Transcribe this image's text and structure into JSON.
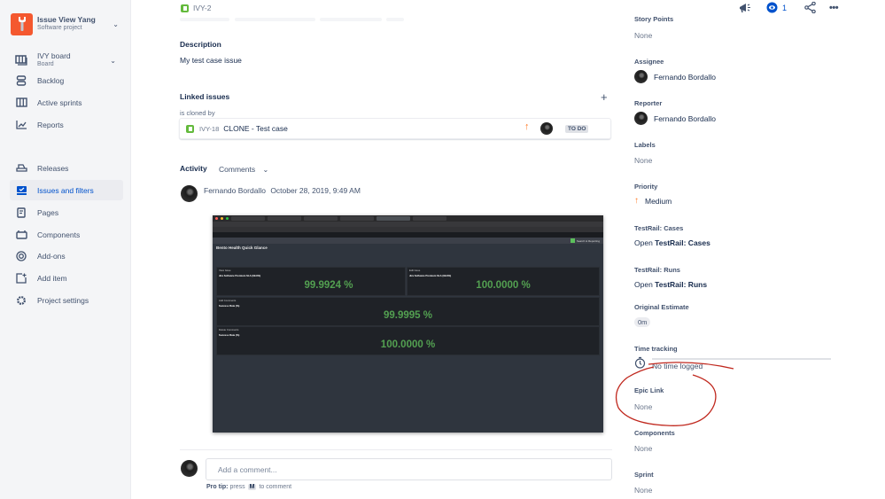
{
  "sidebar": {
    "project": {
      "name": "Issue View Yang",
      "type": "Software project",
      "icon": "wrench-icon",
      "brand_color": "#f4582f"
    },
    "board": {
      "name": "IVY board",
      "sub": "Board"
    },
    "items": [
      {
        "label": "Backlog",
        "icon": "backlog-icon"
      },
      {
        "label": "Active sprints",
        "icon": "sprints-icon"
      },
      {
        "label": "Reports",
        "icon": "reports-icon"
      },
      {
        "label": "Releases",
        "icon": "releases-icon"
      },
      {
        "label": "Issues and filters",
        "icon": "issues-icon",
        "active": true
      },
      {
        "label": "Pages",
        "icon": "pages-icon"
      },
      {
        "label": "Components",
        "icon": "components-icon"
      },
      {
        "label": "Add-ons",
        "icon": "addons-icon"
      },
      {
        "label": "Add item",
        "icon": "add-item-icon"
      },
      {
        "label": "Project settings",
        "icon": "settings-icon"
      }
    ]
  },
  "issue": {
    "key": "IVY-2",
    "description_heading": "Description",
    "description": "My test case issue",
    "linked": {
      "heading": "Linked issues",
      "relation": "is cloned by",
      "items": [
        {
          "key": "IVY-18",
          "summary": "CLONE - Test case",
          "priority": "Medium",
          "status": "TO DO"
        }
      ]
    },
    "activity": {
      "heading": "Activity",
      "filter": "Comments",
      "comments": [
        {
          "author": "Fernando Bordallo",
          "date": "October 28, 2019, 9:49 AM"
        }
      ]
    },
    "comment_box": {
      "placeholder": "Add a comment...",
      "protip_label": "Pro tip:",
      "protip_pre": "press",
      "protip_key": "M",
      "protip_post": "to comment"
    }
  },
  "embedded_screenshot": {
    "app_name": "Search & Reporting",
    "dashboard_title": "Bento Health Quick Glance",
    "panels": [
      {
        "title": "View Issue",
        "subtitle": "Jira Software Premium SLA (99.9%)",
        "value": "99.9924 %"
      },
      {
        "title": "Edit Issue",
        "subtitle": "Jira Software Premium SLA (99.9%)",
        "value": "100.0000 %"
      },
      {
        "title": "Add Comments",
        "subtitle": "Success Rate (%)",
        "value": "99.9995 %"
      },
      {
        "title": "Delete Comments",
        "subtitle": "Success Rate (%)",
        "value": "100.0000 %"
      }
    ],
    "value_color": "#53a051"
  },
  "toolbar": {
    "watch_count": "1"
  },
  "details": {
    "story_points": {
      "label": "Story Points",
      "value": "None"
    },
    "assignee": {
      "label": "Assignee",
      "value": "Fernando Bordallo"
    },
    "reporter": {
      "label": "Reporter",
      "value": "Fernando Bordallo"
    },
    "labels": {
      "label": "Labels",
      "value": "None"
    },
    "priority": {
      "label": "Priority",
      "value": "Medium"
    },
    "testrail_cases": {
      "label": "TestRail: Cases",
      "prefix": "Open",
      "link": "TestRail: Cases"
    },
    "testrail_runs": {
      "label": "TestRail: Runs",
      "prefix": "Open",
      "link": "TestRail: Runs"
    },
    "original_estimate": {
      "label": "Original Estimate",
      "value": "0m"
    },
    "time_tracking": {
      "label": "Time tracking",
      "value": "No time logged"
    },
    "epic_link": {
      "label": "Epic Link",
      "value": "None"
    },
    "components": {
      "label": "Components",
      "value": "None"
    },
    "sprint": {
      "label": "Sprint",
      "value": "None"
    }
  },
  "annotation": {
    "color": "#c0281e"
  }
}
